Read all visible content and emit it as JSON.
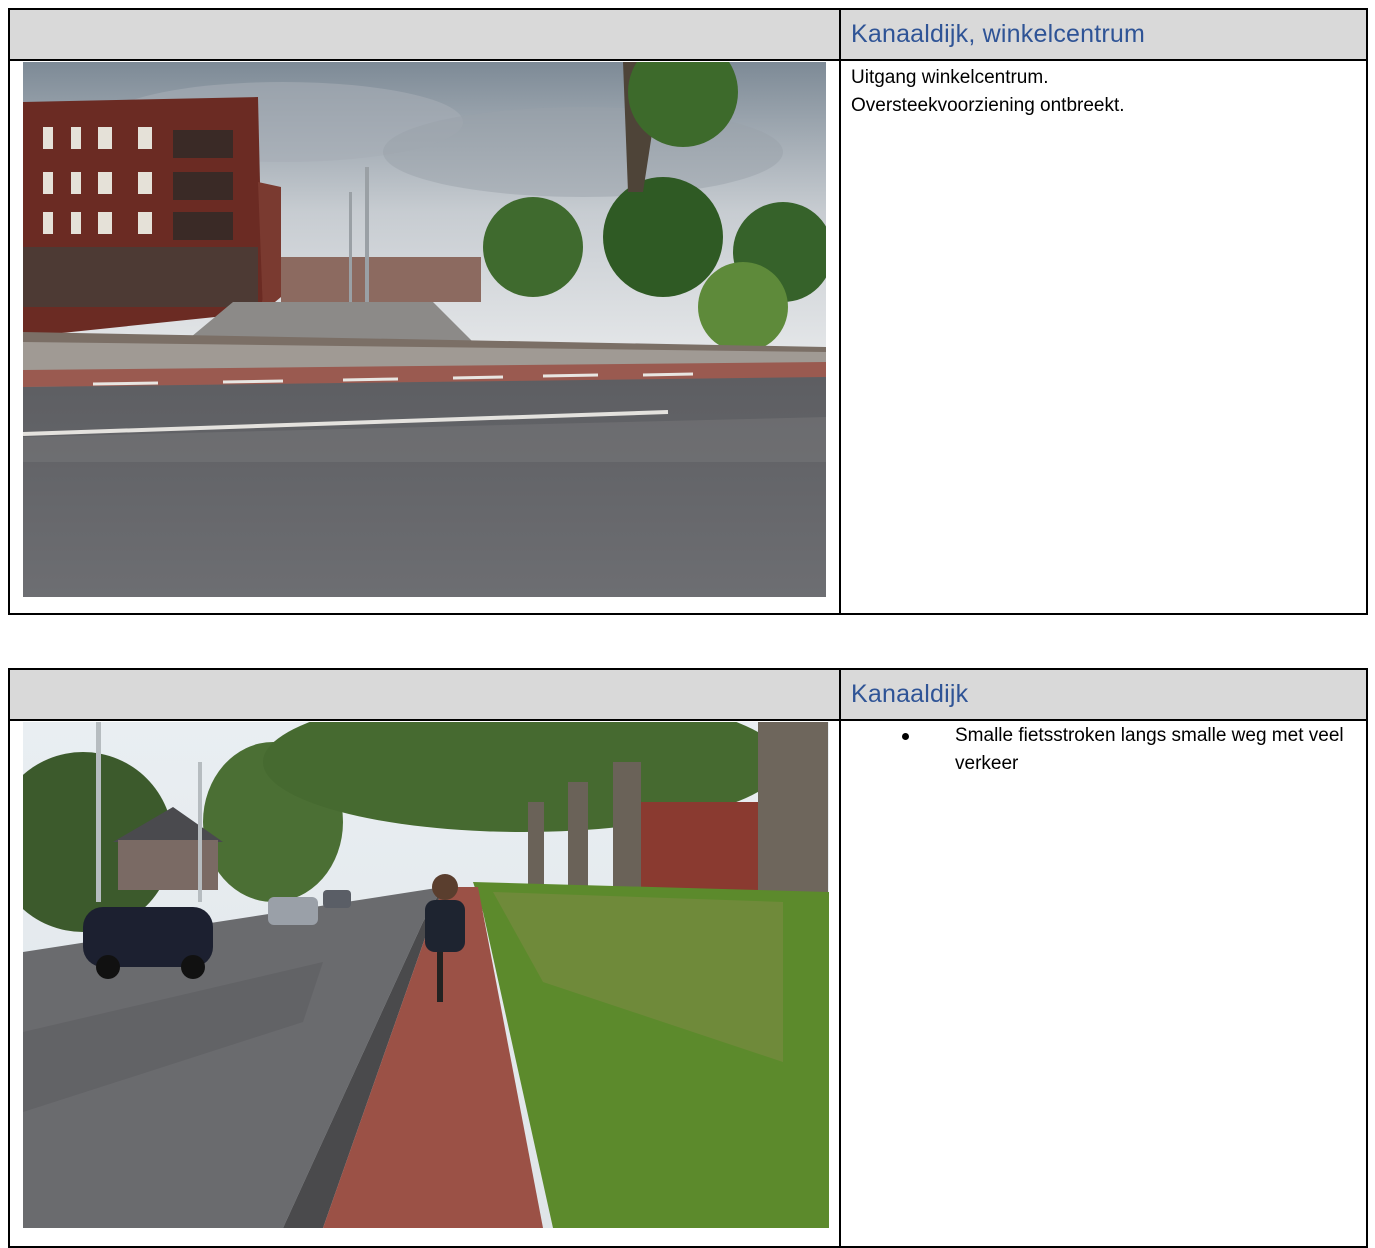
{
  "table1": {
    "header_title": "Kanaaldijk, winkelcentrum",
    "lines": [
      "Uitgang winkelcentrum.",
      "Oversteekvoorziening ontbreekt."
    ]
  },
  "table2": {
    "header_title": "Kanaaldijk",
    "bullets": [
      "Smalle fietsstroken langs smalle weg met veel verkeer"
    ]
  }
}
